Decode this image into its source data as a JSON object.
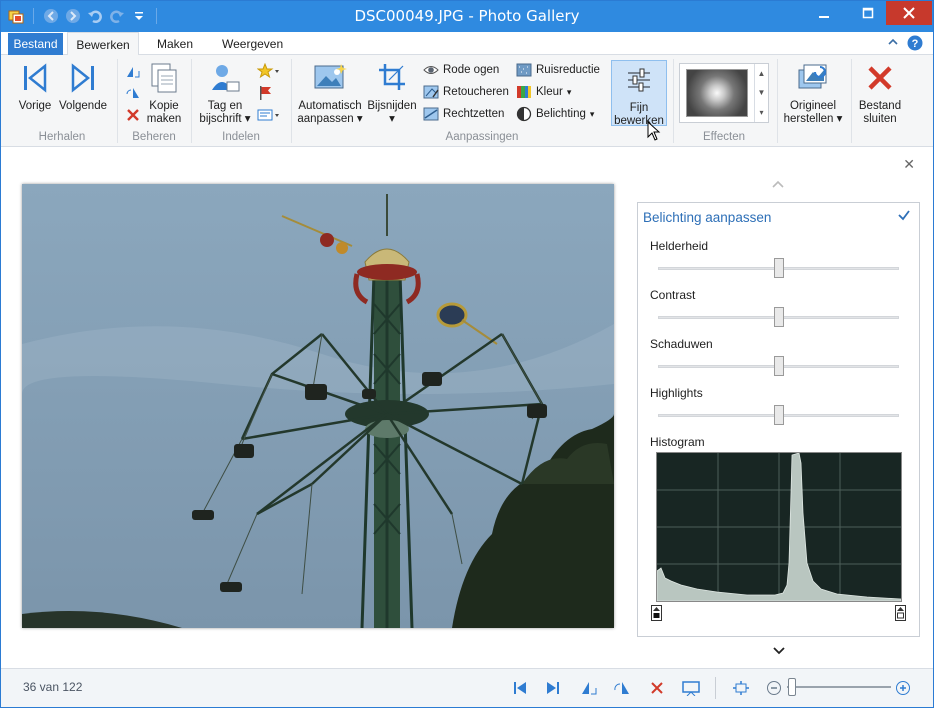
{
  "window": {
    "title": "DSC00049.JPG - Photo Gallery",
    "minimize_icon": "minimize-icon",
    "maximize_icon": "maximize-icon",
    "close_icon": "close-icon"
  },
  "quick_access": [
    "app-icon",
    "back-icon",
    "forward-icon",
    "undo-icon",
    "redo-icon",
    "customize-icon"
  ],
  "tabs": {
    "file": "Bestand",
    "edit": "Bewerken",
    "create": "Maken",
    "view": "Weergeven"
  },
  "ribbon": {
    "groups": {
      "repeat": "Herhalen",
      "manage": "Beheren",
      "organize": "Indelen",
      "adjustments": "Aanpassingen",
      "effects": "Effecten"
    },
    "previous": "Vorige",
    "next": "Volgende",
    "copy_line1": "Kopie",
    "copy_line2": "maken",
    "tag_line1": "Tag en",
    "tag_line2": "bijschrift",
    "auto_line1": "Automatisch",
    "auto_line2": "aanpassen",
    "crop": "Bijsnijden",
    "red_eye": "Rode ogen",
    "retouch": "Retoucheren",
    "straighten": "Rechtzetten",
    "noise": "Ruisreductie",
    "color": "Kleur",
    "exposure": "Belichting",
    "fine_line1": "Fijn",
    "fine_line2": "bewerken",
    "original_line1": "Origineel",
    "original_line2": "herstellen",
    "close_line1": "Bestand",
    "close_line2": "sluiten"
  },
  "panel": {
    "title": "Belichting aanpassen",
    "sliders": [
      {
        "label": "Helderheid",
        "value": 0.5
      },
      {
        "label": "Contrast",
        "value": 0.5
      },
      {
        "label": "Schaduwen",
        "value": 0.5
      },
      {
        "label": "Highlights",
        "value": 0.5
      }
    ],
    "histogram_label": "Histogram"
  },
  "status": {
    "position": "36 van 122",
    "zoom_level": 0.05
  },
  "colors": {
    "accent": "#2f8ae0",
    "panel_title": "#2d6fb7",
    "close_red": "#c7392c"
  }
}
